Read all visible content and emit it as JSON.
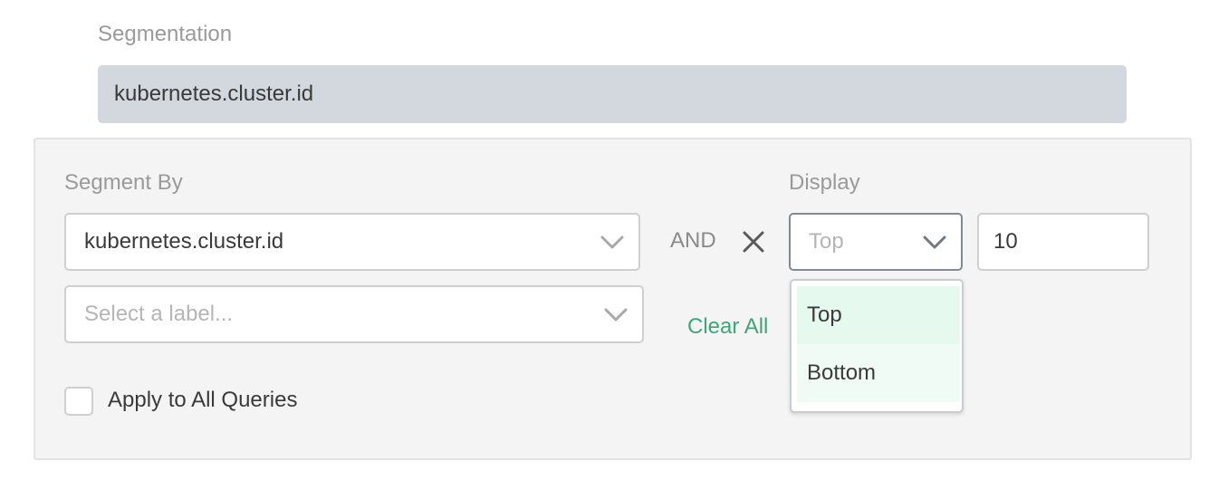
{
  "segmentation": {
    "title": "Segmentation",
    "summary": "kubernetes.cluster.id"
  },
  "segment_by": {
    "label": "Segment By",
    "selected": "kubernetes.cluster.id",
    "label_select_placeholder": "Select a label...",
    "connector": "AND",
    "clear_all": "Clear All"
  },
  "display": {
    "label": "Display",
    "selected_placeholder": "Top",
    "limit_value": "10",
    "options": [
      "Top",
      "Bottom"
    ]
  },
  "apply_all": {
    "label": "Apply to All Queries",
    "checked": false
  },
  "colors": {
    "accent": "#3fa57a",
    "option_highlight": "#e6f9ee",
    "option_bg": "#effbf4",
    "summary_bg": "#d2d8de"
  },
  "icons": {
    "remove": "close-icon",
    "dropdown": "chevron-down-icon"
  }
}
